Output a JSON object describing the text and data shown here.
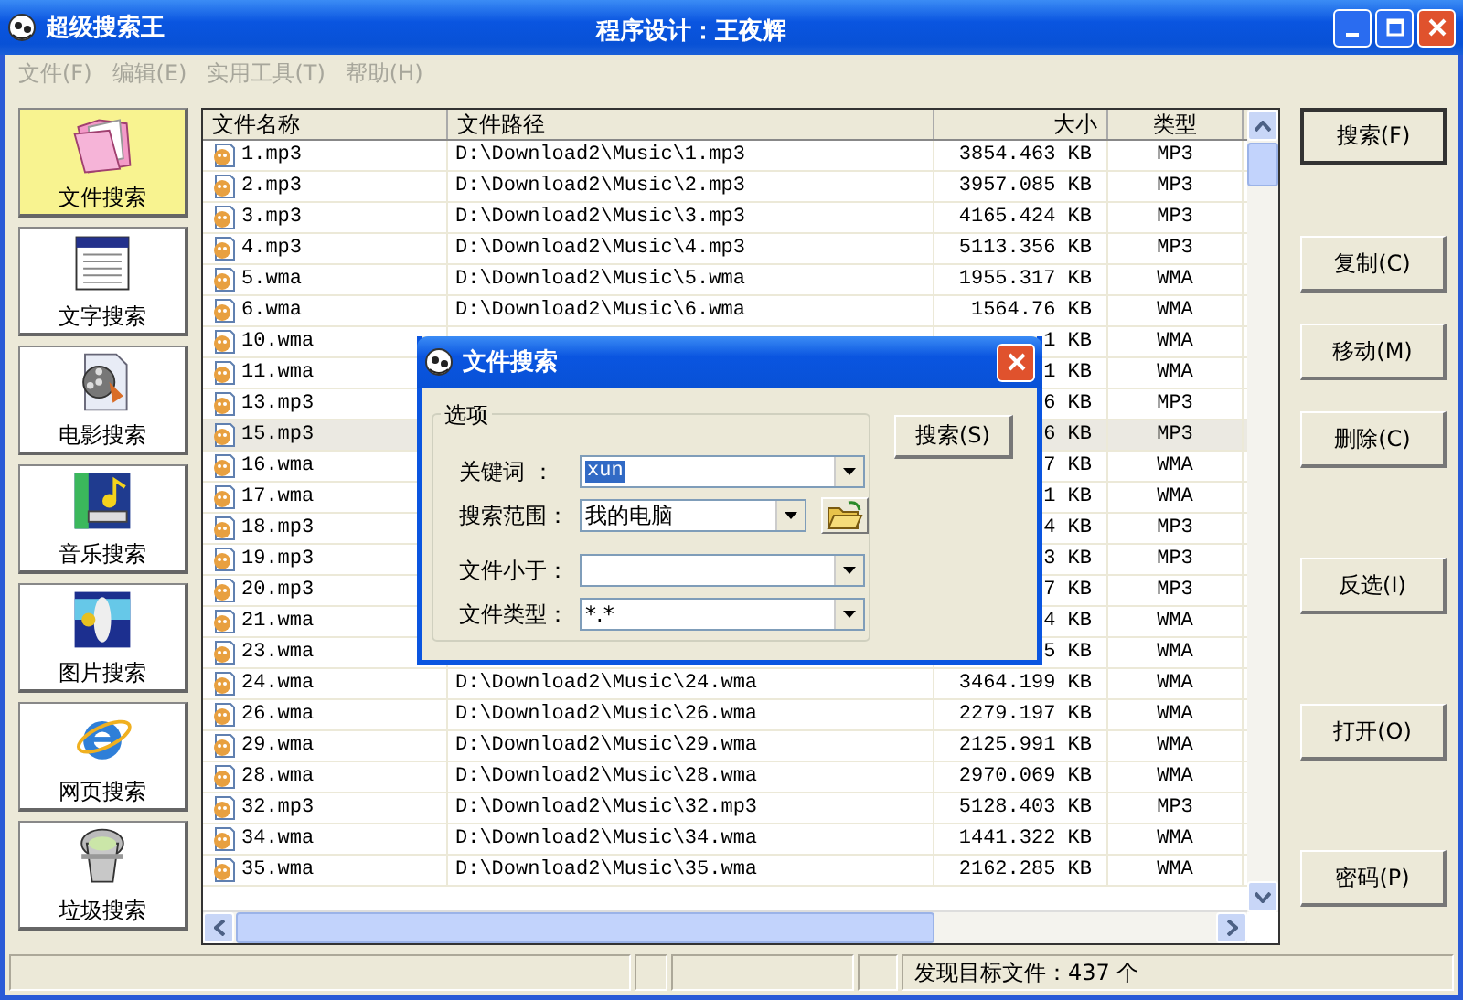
{
  "window": {
    "title": "超级搜索王",
    "subtitle": "程序设计：王夜辉"
  },
  "menu": [
    {
      "label": "文件(F)",
      "disabled": true
    },
    {
      "label": "编辑(E)",
      "disabled": true
    },
    {
      "label": "实用工具(T)",
      "disabled": true
    },
    {
      "label": "帮助(H)",
      "disabled": true
    }
  ],
  "sidebar": {
    "items": [
      {
        "label": "文件搜索",
        "kind": "folder",
        "selected": true
      },
      {
        "label": "文字搜索",
        "kind": "text",
        "selected": false
      },
      {
        "label": "电影搜索",
        "kind": "film",
        "selected": false
      },
      {
        "label": "音乐搜索",
        "kind": "music",
        "selected": false
      },
      {
        "label": "图片搜索",
        "kind": "image",
        "selected": false
      },
      {
        "label": "网页搜索",
        "kind": "web",
        "selected": false
      },
      {
        "label": "垃圾搜索",
        "kind": "trash",
        "selected": false
      }
    ]
  },
  "table": {
    "columns": [
      "文件名称",
      "文件路径",
      "大小",
      "类型"
    ],
    "rows": [
      {
        "name": "1.mp3",
        "path": "D:\\Download2\\Music\\1.mp3",
        "size": "3854.463 KB",
        "type": "MP3",
        "selected": false
      },
      {
        "name": "2.mp3",
        "path": "D:\\Download2\\Music\\2.mp3",
        "size": "3957.085 KB",
        "type": "MP3",
        "selected": false
      },
      {
        "name": "3.mp3",
        "path": "D:\\Download2\\Music\\3.mp3",
        "size": "4165.424 KB",
        "type": "MP3",
        "selected": false
      },
      {
        "name": "4.mp3",
        "path": "D:\\Download2\\Music\\4.mp3",
        "size": "5113.356 KB",
        "type": "MP3",
        "selected": false
      },
      {
        "name": "5.wma",
        "path": "D:\\Download2\\Music\\5.wma",
        "size": "1955.317 KB",
        "type": "WMA",
        "selected": false
      },
      {
        "name": "6.wma",
        "path": "D:\\Download2\\Music\\6.wma",
        "size": "1564.76 KB",
        "type": "WMA",
        "selected": false
      },
      {
        "name": "10.wma",
        "size": "1 KB",
        "type": "WMA",
        "selected": false
      },
      {
        "name": "11.wma",
        "size": "1 KB",
        "type": "WMA",
        "selected": false
      },
      {
        "name": "13.mp3",
        "size": "6 KB",
        "type": "MP3",
        "selected": false
      },
      {
        "name": "15.mp3",
        "size": "6 KB",
        "type": "MP3",
        "selected": true
      },
      {
        "name": "16.wma",
        "size": "7 KB",
        "type": "WMA",
        "selected": false
      },
      {
        "name": "17.wma",
        "size": "1 KB",
        "type": "WMA",
        "selected": false
      },
      {
        "name": "18.mp3",
        "size": "4 KB",
        "type": "MP3",
        "selected": false
      },
      {
        "name": "19.mp3",
        "size": "3 KB",
        "type": "MP3",
        "selected": false
      },
      {
        "name": "20.mp3",
        "size": "7 KB",
        "type": "MP3",
        "selected": false
      },
      {
        "name": "21.wma",
        "size": "4 KB",
        "type": "WMA",
        "selected": false
      },
      {
        "name": "23.wma",
        "size": "5 KB",
        "type": "WMA",
        "selected": false
      },
      {
        "name": "24.wma",
        "path": "D:\\Download2\\Music\\24.wma",
        "size": "3464.199 KB",
        "type": "WMA",
        "selected": false
      },
      {
        "name": "26.wma",
        "path": "D:\\Download2\\Music\\26.wma",
        "size": "2279.197 KB",
        "type": "WMA",
        "selected": false
      },
      {
        "name": "29.wma",
        "path": "D:\\Download2\\Music\\29.wma",
        "size": "2125.991 KB",
        "type": "WMA",
        "selected": false
      },
      {
        "name": "28.wma",
        "path": "D:\\Download2\\Music\\28.wma",
        "size": "2970.069 KB",
        "type": "WMA",
        "selected": false
      },
      {
        "name": "32.mp3",
        "path": "D:\\Download2\\Music\\32.mp3",
        "size": "5128.403 KB",
        "type": "MP3",
        "selected": false
      },
      {
        "name": "34.wma",
        "path": "D:\\Download2\\Music\\34.wma",
        "size": "1441.322 KB",
        "type": "WMA",
        "selected": false
      },
      {
        "name": "35.wma",
        "path": "D:\\Download2\\Music\\35.wma",
        "size": "2162.285 KB",
        "type": "WMA",
        "selected": false
      }
    ]
  },
  "actions": [
    "搜索(F)",
    "复制(C)",
    "移动(M)",
    "删除(C)",
    "反选(I)",
    "打开(O)",
    "密码(P)"
  ],
  "status_bar": {
    "text": "发现目标文件：437 个"
  },
  "dialog": {
    "title": "文件搜索",
    "group": "选项",
    "fields": [
      {
        "label": "关键词 ：",
        "value": "xun",
        "kind": "combo"
      },
      {
        "label": "搜索范围：",
        "value": "我的电脑",
        "kind": "browse"
      },
      {
        "label": "文件小于：",
        "kind": "combo"
      },
      {
        "label": "文件类型：",
        "value": "*.*",
        "kind": "combo"
      }
    ],
    "button": "搜索(S)"
  }
}
